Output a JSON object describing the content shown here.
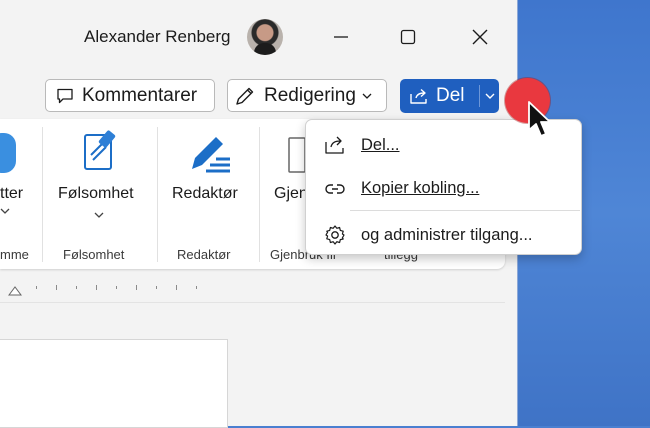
{
  "titlebar": {
    "user_name": "Alexander Renberg"
  },
  "commands": {
    "comments_label": "Kommentarer",
    "editing_label": "Redigering",
    "share_label": "Del"
  },
  "ribbon": {
    "partial_left_label": "tter",
    "partial_left_group": "mme",
    "sensitivity_label": "Følsomhet",
    "sensitivity_group": "Følsomhet",
    "editor_label": "Redaktør",
    "editor_group": "Redaktør",
    "reuse_label": "Gjen",
    "reuse_group": "Gjenbruk fil",
    "partial_right_group": "tillegg"
  },
  "share_menu": {
    "items": [
      {
        "label": "Del...",
        "icon": "share-icon"
      },
      {
        "label": "Kopier kobling...",
        "icon": "link-icon"
      },
      {
        "label": "og administrer tilgang...",
        "icon": "gear-icon"
      }
    ]
  },
  "colors": {
    "accent": "#1f5fbf",
    "desktop": "#4a7fd0",
    "highlight_dot": "#e9383f"
  }
}
